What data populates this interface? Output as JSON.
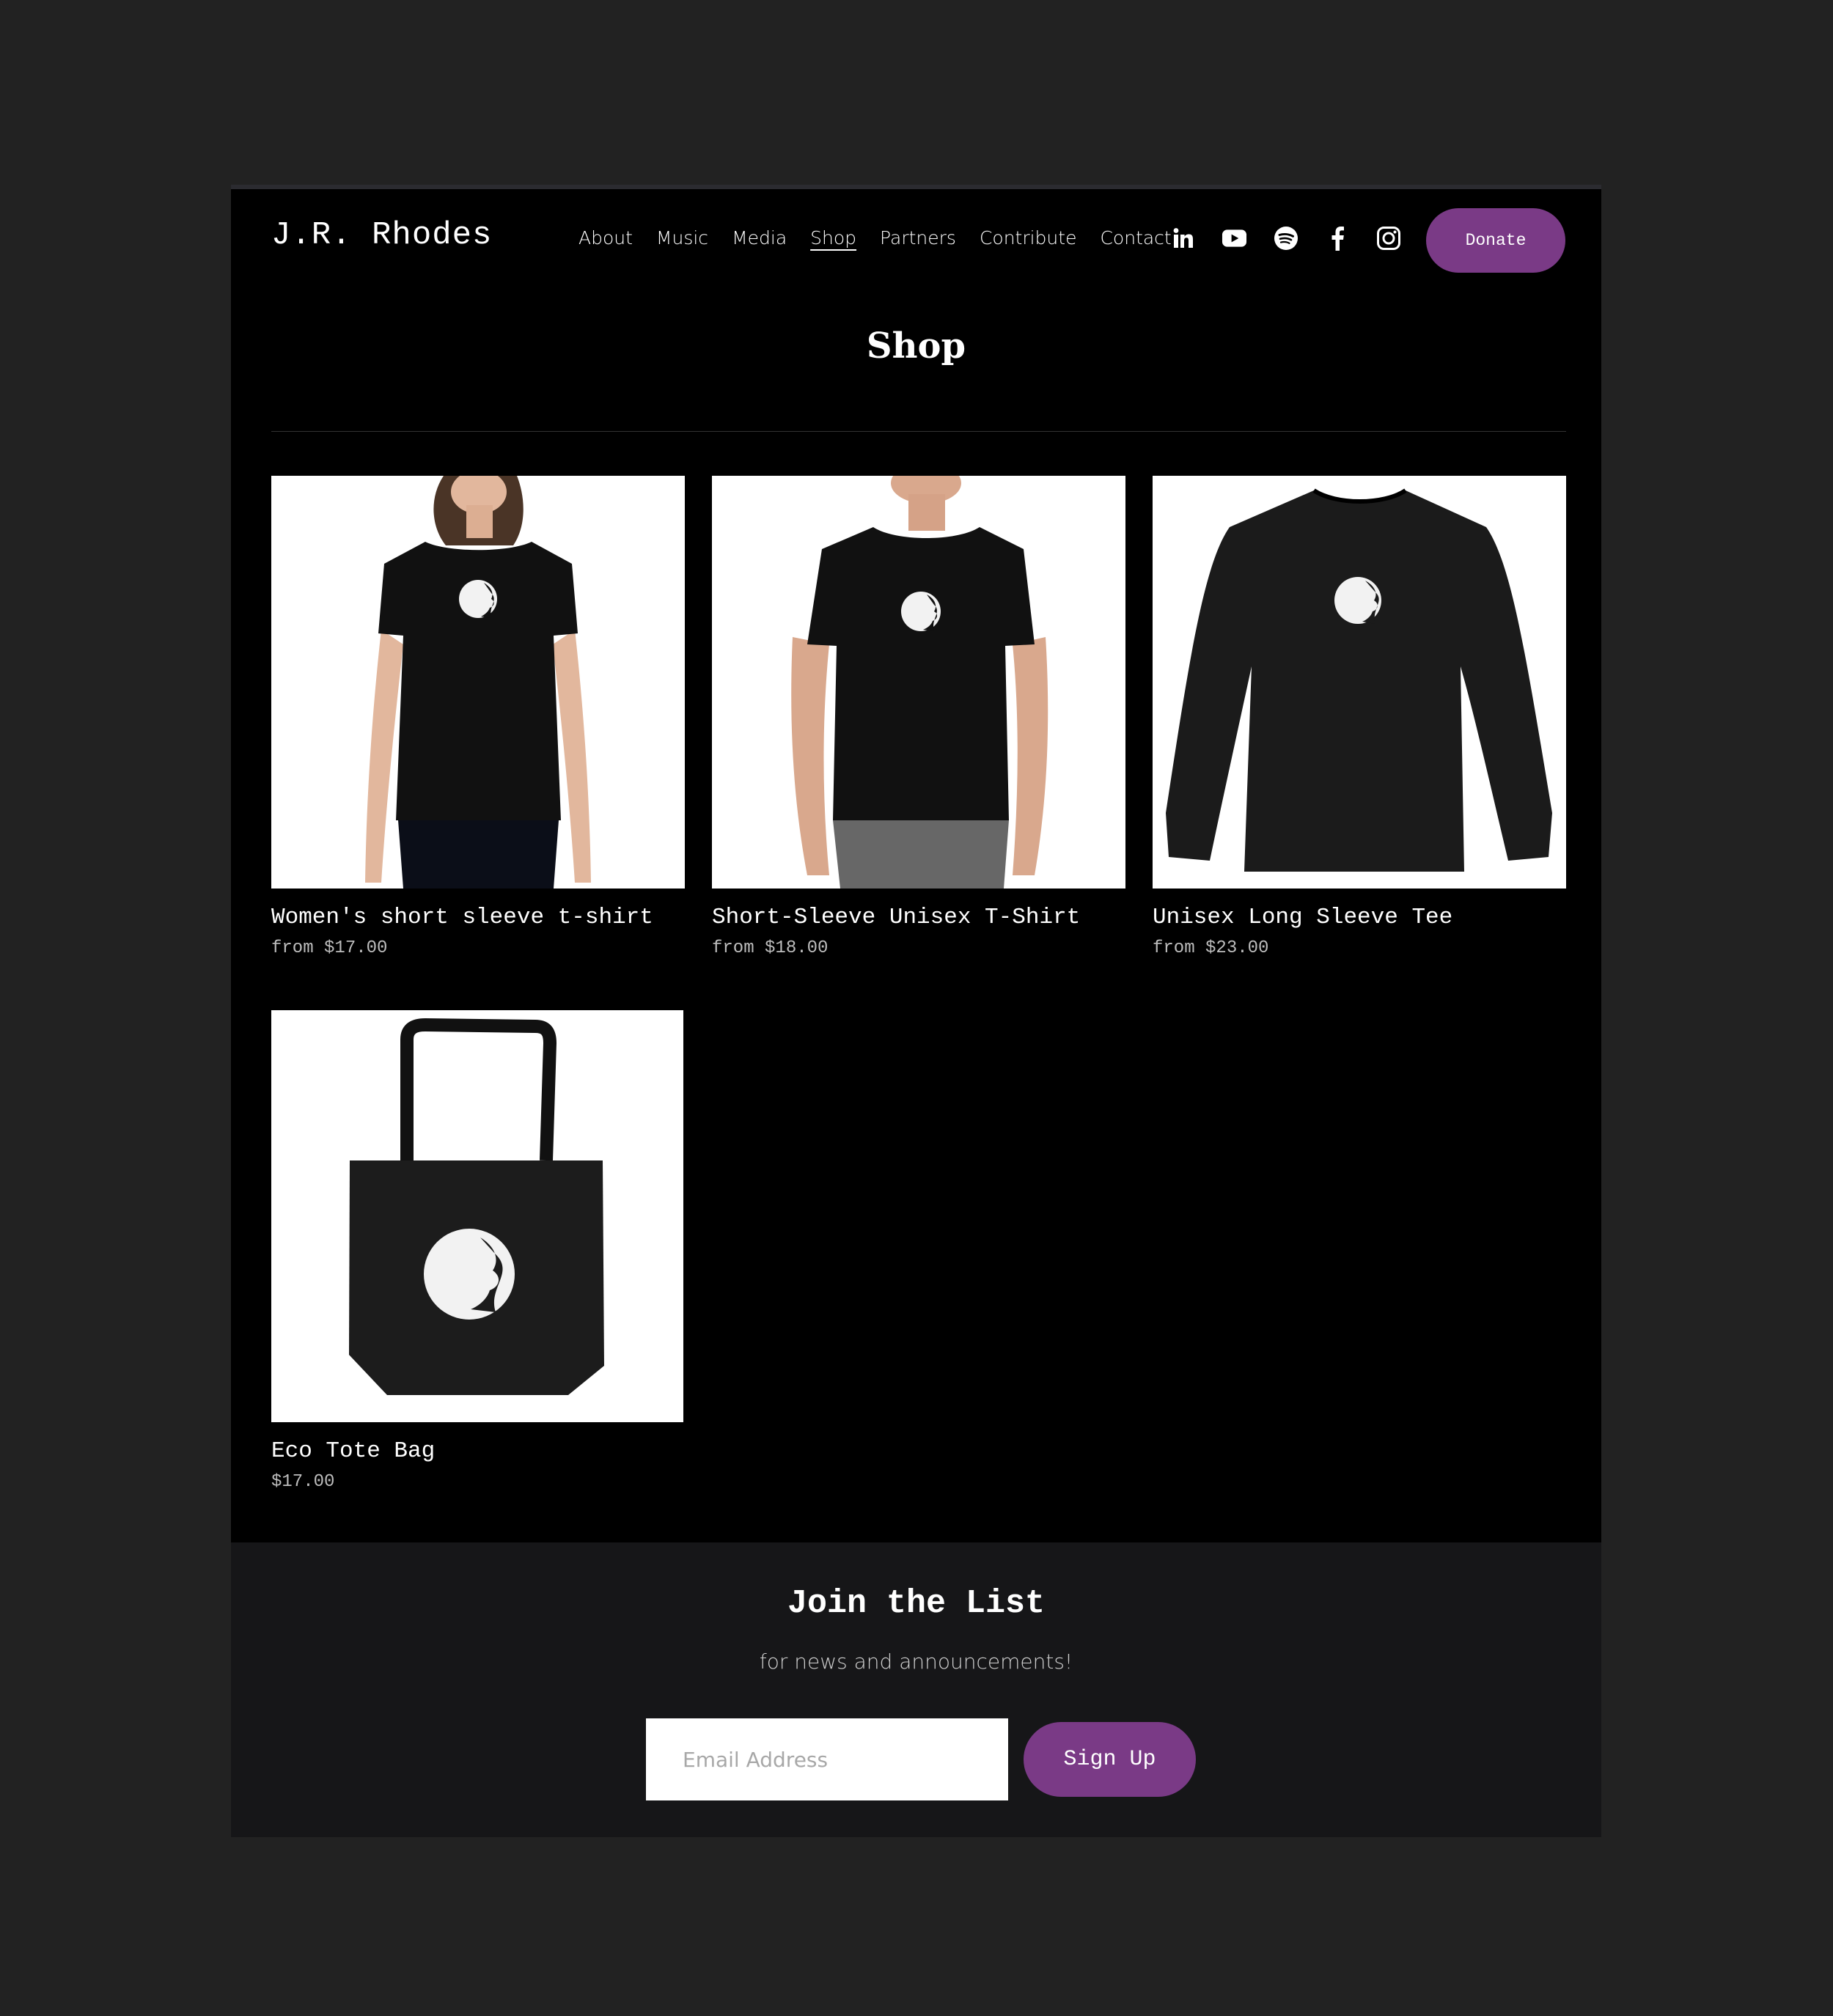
{
  "header": {
    "logo": "J.R. Rhodes",
    "nav": [
      {
        "label": "About",
        "active": false
      },
      {
        "label": "Music",
        "active": false
      },
      {
        "label": "Media",
        "active": false
      },
      {
        "label": "Shop",
        "active": true
      },
      {
        "label": "Partners",
        "active": false
      },
      {
        "label": "Contact",
        "active": false
      }
    ],
    "nav_contribute": "Contribute",
    "socials": [
      "linkedin-icon",
      "youtube-icon",
      "spotify-icon",
      "facebook-icon",
      "instagram-icon"
    ],
    "donate_label": "Donate"
  },
  "page": {
    "title": "Shop"
  },
  "products": [
    {
      "name": "Women's short sleeve t-shirt",
      "price": "from $17.00",
      "image": "womens-tshirt"
    },
    {
      "name": "Short-Sleeve Unisex T-Shirt",
      "price": "from $18.00",
      "image": "unisex-tshirt"
    },
    {
      "name": "Unisex Long Sleeve Tee",
      "price": "from $23.00",
      "image": "long-sleeve-tee"
    },
    {
      "name": "Eco Tote Bag",
      "price": "$17.00",
      "image": "tote-bag"
    }
  ],
  "signup": {
    "title": "Join the List",
    "subtitle": "for news and announcements!",
    "email_placeholder": "Email Address",
    "button_label": "Sign Up"
  },
  "colors": {
    "background": "#222222",
    "site_background": "#000000",
    "accent": "#7a3a86",
    "footer_background": "#161618"
  }
}
